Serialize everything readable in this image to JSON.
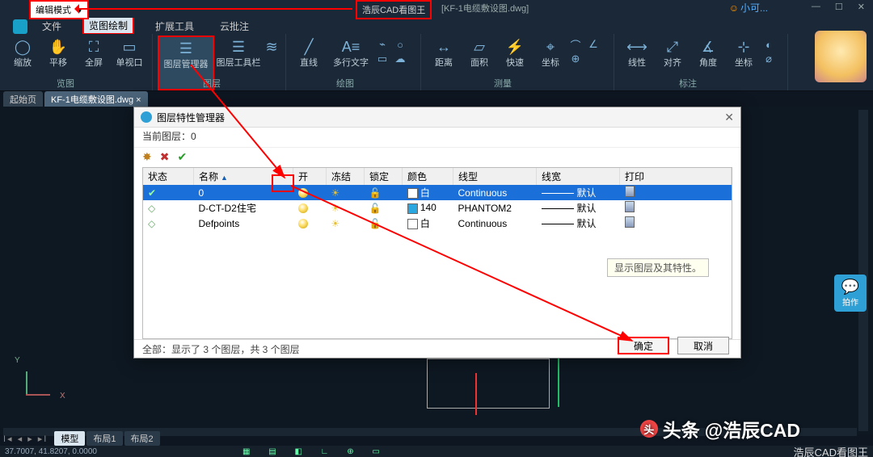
{
  "title": {
    "mode": "编辑模式",
    "app": "浩辰CAD看图王",
    "file": "[KF-1电缆敷设图.dwg]",
    "user": "小可..."
  },
  "win_controls": {
    "min": "—",
    "max": "☐",
    "close": "✕"
  },
  "menu": {
    "file": "文件",
    "view_active": "览图绘制",
    "ext": "扩展工具",
    "cloud": "云批注"
  },
  "ribbon": {
    "view": {
      "label": "览图",
      "zoom": "缩放",
      "pan": "平移",
      "full": "全屏",
      "vport": "单视口"
    },
    "layer": {
      "label": "图层",
      "mgr": "图层管理器",
      "bar": "图层工具栏"
    },
    "draw": {
      "label": "绘图",
      "line": "直线",
      "mtext": "多行文字"
    },
    "measure": {
      "label": "测量",
      "dist": "距离",
      "area": "面积",
      "quick": "快速",
      "coord": "坐标"
    },
    "dim": {
      "label": "标注",
      "linear": "线性",
      "align": "对齐",
      "angle": "角度",
      "ord": "坐标"
    }
  },
  "doctabs": {
    "start": "起始页",
    "active": "KF-1电缆敷设图.dwg"
  },
  "dialog": {
    "title": "图层特性管理器",
    "current": "当前图层：0",
    "cols": {
      "state": "状态",
      "name": "名称",
      "on": "开",
      "freeze": "冻结",
      "lock": "锁定",
      "color": "颜色",
      "ltype": "线型",
      "lweight": "线宽",
      "plot": "打印"
    },
    "rows": [
      {
        "name": "0",
        "color_name": "白",
        "color": "#ffffff",
        "ltype": "Continuous",
        "lw": "默认",
        "on": true,
        "sel": true
      },
      {
        "name": "D-CT-D2住宅",
        "color_name": "140",
        "color": "#2aa6e0",
        "ltype": "PHANTOM2",
        "lw": "默认",
        "on": true,
        "sel": false
      },
      {
        "name": "Defpoints",
        "color_name": "白",
        "color": "#ffffff",
        "ltype": "Continuous",
        "lw": "默认",
        "on": true,
        "sel": false
      }
    ],
    "tip": "显示图层及其特性。",
    "status": "全部：显示了 3 个图层，共 3 个图层",
    "ok": "确定",
    "cancel": "取消"
  },
  "side_action": "拍作",
  "layouts": {
    "nav": "I◂ ◂ ▸ ▸I",
    "model": "模型",
    "l1": "布局1",
    "l2": "布局2"
  },
  "status": {
    "coords": "37.7007, 41.8207, 0.0000",
    "right": "浩辰CAD看图王"
  },
  "watermark": {
    "prefix": "头条",
    "author": "@浩辰CAD"
  }
}
